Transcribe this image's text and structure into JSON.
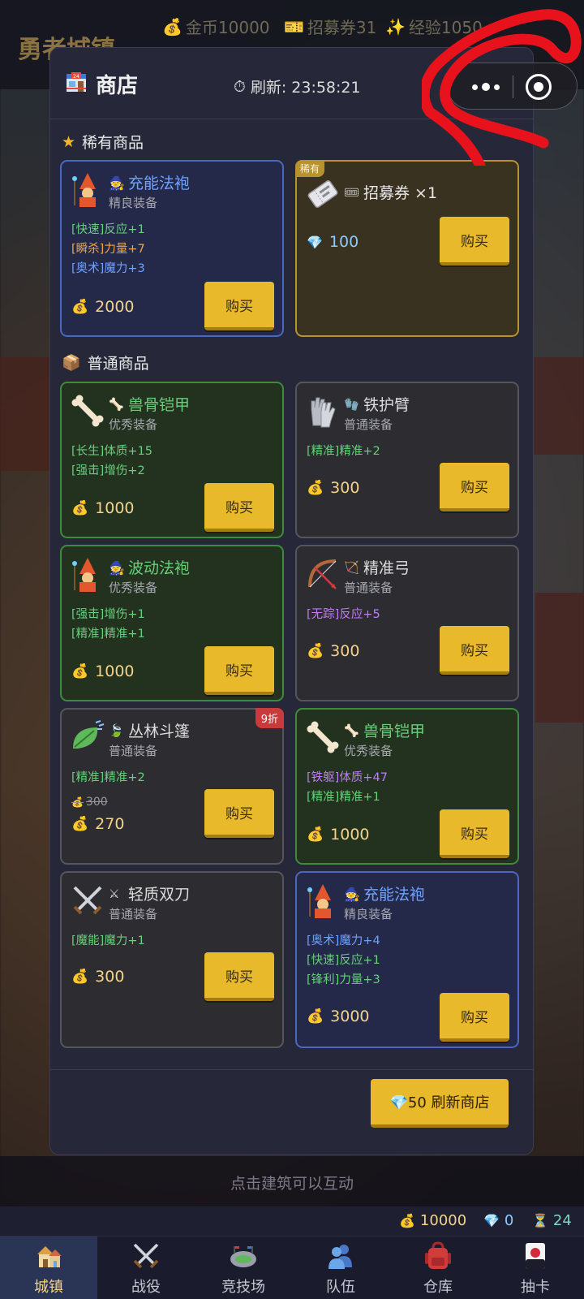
{
  "town": {
    "title": "勇者城镇",
    "hud": {
      "gold": "金币10000",
      "tickets": "招募券31",
      "exp": "经验1050"
    }
  },
  "shop": {
    "title": "商店",
    "refresh_timer": "刷新: 23:58:21",
    "rare_section": "稀有商品",
    "normal_section": "普通商品",
    "buy_label": "购买",
    "rare_tag": "稀有",
    "refresh_button": "💎50 刷新商店",
    "rare_items": [
      {
        "name": "充能法袍",
        "grade": "精良装备",
        "icon": "wizard-icon",
        "rarity": "blue",
        "stats": [
          {
            "text": "[快速]反应+1",
            "color": "green"
          },
          {
            "text": "[瞬杀]力量+7",
            "color": "orange"
          },
          {
            "text": "[奥术]魔力+3",
            "color": "blue"
          }
        ],
        "price": "2000",
        "currency": "gold"
      },
      {
        "name": "招募券 ×1",
        "icon": "ticket-icon",
        "rarity": "gold",
        "price": "100",
        "currency": "diamond"
      }
    ],
    "normal_items": [
      {
        "name": "兽骨铠甲",
        "grade": "优秀装备",
        "icon": "bone-icon",
        "rarity": "green",
        "stats": [
          {
            "text": "[长生]体质+15",
            "color": "green"
          },
          {
            "text": "[强击]增伤+2",
            "color": "green"
          }
        ],
        "price": "1000"
      },
      {
        "name": "铁护臂",
        "grade": "普通装备",
        "icon": "gloves-icon",
        "rarity": "gray",
        "stats": [
          {
            "text": "[精准]精准+2",
            "color": "green"
          }
        ],
        "price": "300"
      },
      {
        "name": "波动法袍",
        "grade": "优秀装备",
        "icon": "wizard-icon",
        "rarity": "green",
        "stats": [
          {
            "text": "[强击]增伤+1",
            "color": "green"
          },
          {
            "text": "[精准]精准+1",
            "color": "green"
          }
        ],
        "price": "1000"
      },
      {
        "name": "精准弓",
        "grade": "普通装备",
        "icon": "bow-icon",
        "rarity": "gray",
        "stats": [
          {
            "text": "[无踪]反应+5",
            "color": "purple"
          }
        ],
        "price": "300"
      },
      {
        "name": "丛林斗篷",
        "grade": "普通装备",
        "icon": "leaf-icon",
        "rarity": "gray",
        "stats": [
          {
            "text": "[精准]精准+2",
            "color": "green"
          }
        ],
        "old_price": "300",
        "price": "270",
        "discount": "9折"
      },
      {
        "name": "兽骨铠甲",
        "grade": "优秀装备",
        "icon": "bone-icon",
        "rarity": "green",
        "stats": [
          {
            "text": "[铁躯]体质+47",
            "color": "purple"
          },
          {
            "text": "[精准]精准+1",
            "color": "green"
          }
        ],
        "price": "1000"
      },
      {
        "name": "轻质双刀",
        "grade": "普通装备",
        "icon": "crossed-swords-icon",
        "rarity": "gray",
        "stats": [
          {
            "text": "[魔能]魔力+1",
            "color": "green"
          }
        ],
        "price": "300"
      },
      {
        "name": "充能法袍",
        "grade": "精良装备",
        "icon": "wizard-icon",
        "rarity": "blue",
        "stats": [
          {
            "text": "[奥术]魔力+4",
            "color": "blue"
          },
          {
            "text": "[快速]反应+1",
            "color": "green"
          },
          {
            "text": "[锋利]力量+3",
            "color": "green"
          }
        ],
        "price": "3000"
      }
    ]
  },
  "hint": "点击建筑可以互动",
  "status": {
    "gold": "10000",
    "diamond": "0",
    "hourglass": "24"
  },
  "nav": [
    {
      "label": "城镇",
      "icon": "houses-icon",
      "active": true
    },
    {
      "label": "战役",
      "icon": "crossed-swords-icon",
      "active": false
    },
    {
      "label": "竞技场",
      "icon": "stadium-icon",
      "active": false
    },
    {
      "label": "队伍",
      "icon": "people-icon",
      "active": false
    },
    {
      "label": "仓库",
      "icon": "backpack-icon",
      "active": false
    },
    {
      "label": "抽卡",
      "icon": "card-icon",
      "active": false
    }
  ],
  "colors": {
    "gold_button": "#e8b92a",
    "annotation": "#e8121c",
    "accent_text": "#f3d38a"
  }
}
